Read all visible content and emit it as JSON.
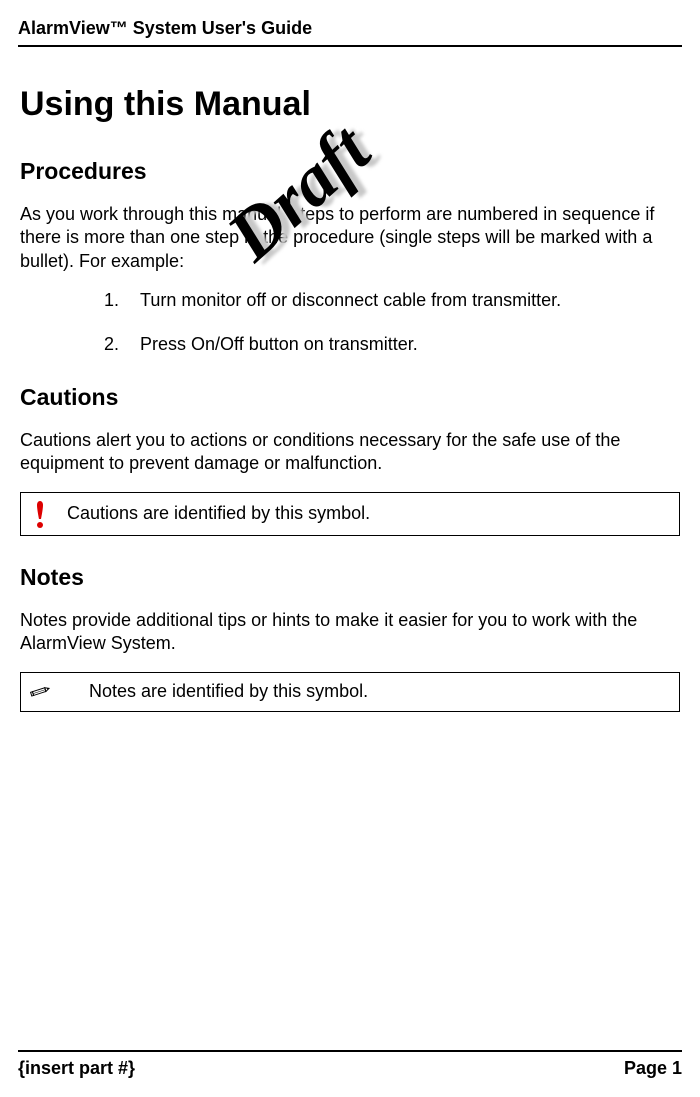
{
  "header": {
    "title": "AlarmView™ System User's Guide"
  },
  "watermark": {
    "text": "Draft"
  },
  "main": {
    "h1": "Using this Manual",
    "sections": {
      "procedures": {
        "heading": "Procedures",
        "para": "As you work through this manual, steps to perform are numbered in sequence if there is more than one step in the procedure (single steps will be marked with a bullet). For example:",
        "steps": [
          "Turn monitor off or disconnect cable from transmitter.",
          "Press On/Off button on transmitter."
        ]
      },
      "cautions": {
        "heading": "Cautions",
        "para": "Cautions alert you to actions or conditions necessary for the safe use of the equipment to prevent damage or malfunction.",
        "callout": "Cautions are identified by this symbol."
      },
      "notes": {
        "heading": "Notes",
        "para": "Notes provide additional tips or hints to make it easier for you to work with the AlarmView System.",
        "callout": "Notes are identified by this symbol."
      }
    }
  },
  "footer": {
    "left": "{insert part #}",
    "right": "Page 1"
  }
}
